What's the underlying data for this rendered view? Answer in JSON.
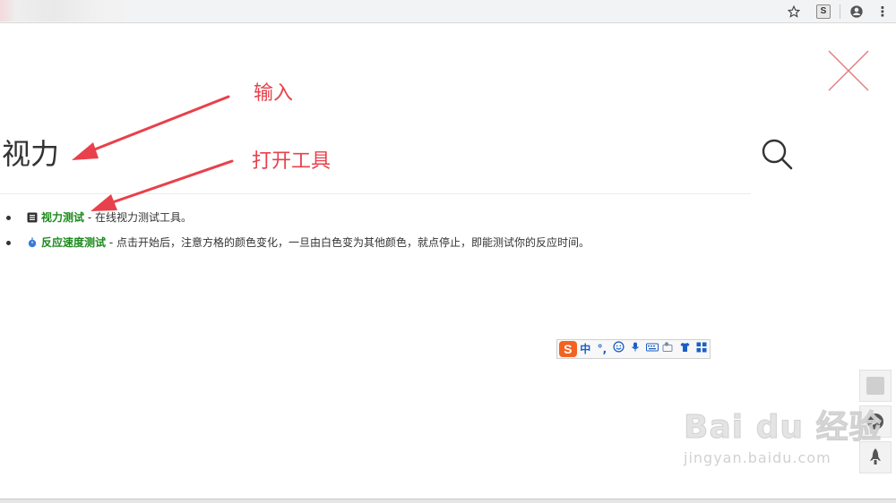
{
  "browser": {
    "toolbar_icons": [
      "star-icon",
      "extension-icon",
      "account-icon",
      "more-icon"
    ],
    "extension_letter": "S",
    "more_glyph": "⋮"
  },
  "search": {
    "query": "视力"
  },
  "results": [
    {
      "icon": "document-icon",
      "title": "视力测试",
      "desc": " - 在线视力测试工具。"
    },
    {
      "icon": "timer-icon",
      "title": "反应速度测试",
      "desc": " - 点击开始后，注意方格的颜色变化，一旦由白色变为其他颜色，就点停止，即能测试你的反应时间。"
    }
  ],
  "annotations": {
    "input_label": "输入",
    "open_tool_label": "打开工具"
  },
  "ime": {
    "logo": "S",
    "mode": "中",
    "punct": "°,",
    "items": [
      "emoji-icon",
      "mic-icon",
      "keyboard-icon",
      "handwrite-icon",
      "skin-icon",
      "toolbox-icon"
    ]
  },
  "watermark": {
    "brand": "Bai du 经验",
    "domain": "jingyan.baidu.com"
  },
  "colors": {
    "annotation": "#e8414b",
    "result_title": "#1a8a1a",
    "close_x": "#e07a7a",
    "ime_logo": "#f26322"
  }
}
